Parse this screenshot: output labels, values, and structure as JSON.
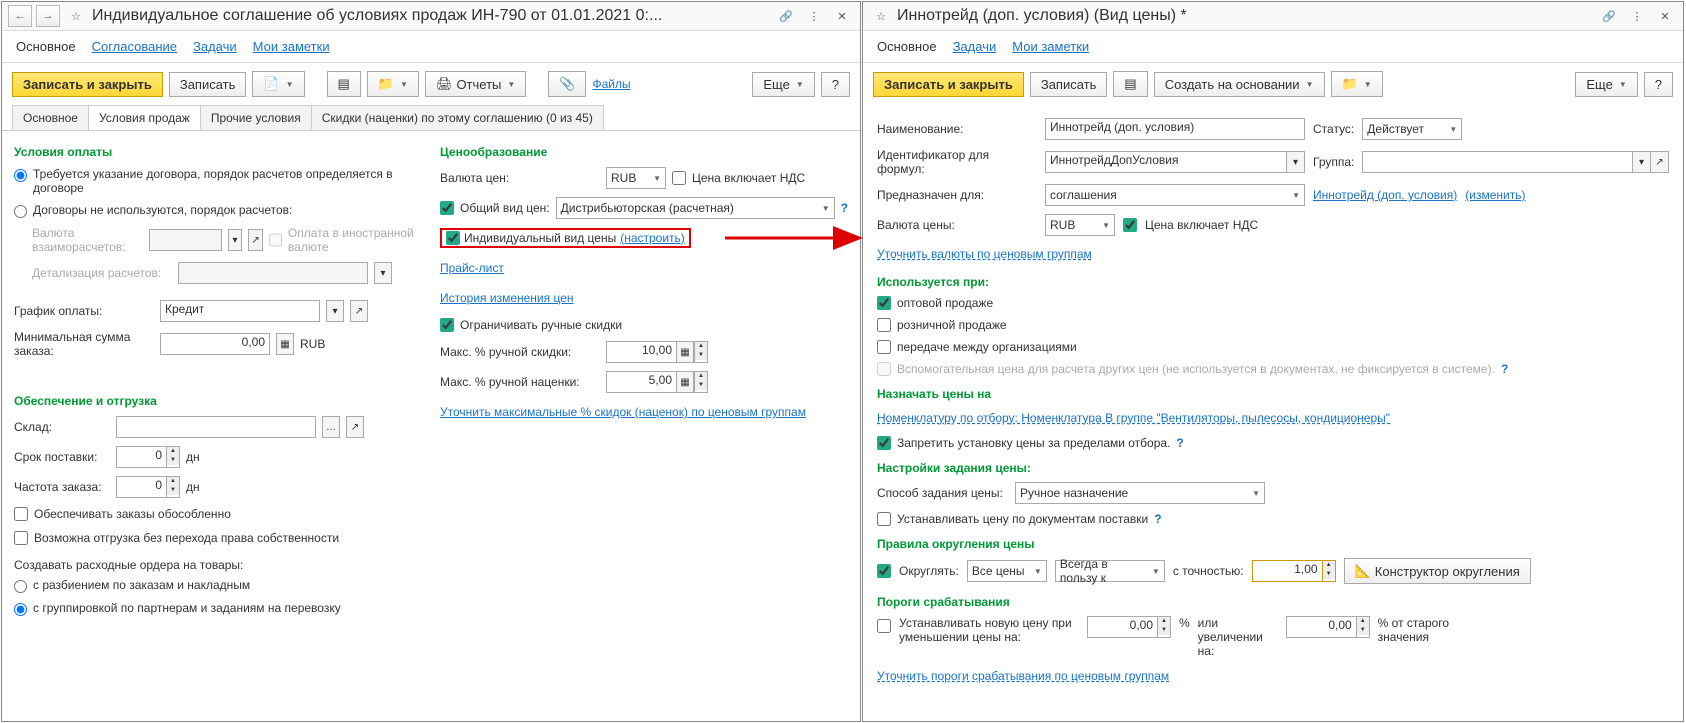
{
  "left": {
    "title": "Индивидуальное соглашение об условиях продаж ИН-790 от 01.01.2021 0:...",
    "nav": {
      "main": "Основное",
      "approve": "Согласование",
      "tasks": "Задачи",
      "notes": "Мои заметки"
    },
    "toolbar": {
      "save_close": "Записать и закрыть",
      "save": "Записать",
      "reports": "Отчеты",
      "files": "Файлы",
      "more": "Еще"
    },
    "sub_tabs": {
      "main": "Основное",
      "sales": "Условия продаж",
      "other": "Прочие условия",
      "discounts": "Скидки (наценки) по этому соглашению (0 из 45)"
    },
    "payment": {
      "head": "Условия оплаты",
      "opt1": "Требуется указание договора, порядок расчетов определяется в договоре",
      "opt2": "Договоры не используются, порядок расчетов:",
      "curr_lbl": "Валюта взаиморасчетов:",
      "foreign": "Оплата в иностранной валюте",
      "detail_lbl": "Детализация расчетов:",
      "schedule_lbl": "График оплаты:",
      "schedule_val": "Кредит",
      "minsum_lbl": "Минимальная сумма заказа:",
      "minsum_val": "0,00",
      "minsum_unit": "RUB"
    },
    "pricing": {
      "head": "Ценообразование",
      "curr_lbl": "Валюта цен:",
      "curr_val": "RUB",
      "vat": "Цена включает НДС",
      "common_lbl": "Общий вид цен:",
      "common_val": "Дистрибьюторская (расчетная)",
      "individual": "Индивидуальный вид цены",
      "configure": "(настроить)",
      "pricelist": "Прайс-лист",
      "history": "История изменения цен",
      "limit": "Ограничивать ручные скидки",
      "maxdisc_lbl": "Макс. % ручной скидки:",
      "maxdisc_val": "10,00",
      "maxmark_lbl": "Макс. % ручной наценки:",
      "maxmark_val": "5,00",
      "refine": "Уточнить максимальные % скидок (наценок) по ценовым группам"
    },
    "shipping": {
      "head": "Обеспечение и отгрузка",
      "wh_lbl": "Склад:",
      "term_lbl": "Срок поставки:",
      "term_val": "0",
      "term_unit": "дн",
      "freq_lbl": "Частота заказа:",
      "freq_val": "0",
      "freq_unit": "дн",
      "sep": "Обеспечивать заказы обособленно",
      "noown": "Возможна отгрузка без перехода права собственности",
      "orders_lbl": "Создавать расходные ордера на товары:",
      "byorder": "с разбиением по заказам и накладным",
      "bygroup": "с группировкой по партнерам и заданиям на перевозку"
    }
  },
  "right": {
    "title": "Иннотрейд (доп. условия) (Вид цены) *",
    "nav": {
      "main": "Основное",
      "tasks": "Задачи",
      "notes": "Мои заметки"
    },
    "toolbar": {
      "save_close": "Записать и закрыть",
      "save": "Записать",
      "create_base": "Создать на основании",
      "more": "Еще"
    },
    "fields": {
      "name_lbl": "Наименование:",
      "name_val": "Иннотрейд (доп. условия)",
      "status_lbl": "Статус:",
      "status_val": "Действует",
      "id_lbl": "Идентификатор для формул:",
      "id_val": "ИннотрейдДопУсловия",
      "group_lbl": "Группа:",
      "for_lbl": "Предназначен для:",
      "for_val": "соглашения",
      "for_link": "Иннотрейд (доп. условия)",
      "for_change": "(изменить)",
      "curr_lbl": "Валюта цены:",
      "curr_val": "RUB",
      "vat": "Цена включает НДС",
      "refine_curr": "Уточнить валюты по ценовым группам"
    },
    "used": {
      "head": "Используется при:",
      "wholesale": "оптовой продаже",
      "retail": "розничной продаже",
      "transfer": "передаче между организациями",
      "aux": "Вспомогательная цена для расчета других цен (не используется в документах, не фиксируется в системе)."
    },
    "assign": {
      "head": "Назначать цены на",
      "link": "Номенклатуру по отбору: Номенклатура В группе \"Вентиляторы, пылесосы, кондиционеры\"",
      "forbid": "Запретить установку цены за пределами отбора."
    },
    "settings": {
      "head": "Настройки задания цены:",
      "method_lbl": "Способ задания цены:",
      "method_val": "Ручное назначение",
      "bydoc": "Устанавливать цену по документам поставки"
    },
    "rounding": {
      "head": "Правила округления цены",
      "round_lbl": "Округлять:",
      "all": "Все цены",
      "rule": "Всегда в пользу к",
      "precision_lbl": "с точностью:",
      "precision_val": "1,00",
      "constructor": "Конструктор округления"
    },
    "thresholds": {
      "head": "Пороги срабатывания",
      "dec_lbl": "Устанавливать новую цену при уменьшении цены на:",
      "dec_val": "0,00",
      "pct": "%",
      "inc_lbl": "или увеличении на:",
      "inc_val": "0,00",
      "inc_suffix": "% от старого значения",
      "refine": "Уточнить пороги срабатывания по ценовым группам"
    }
  }
}
